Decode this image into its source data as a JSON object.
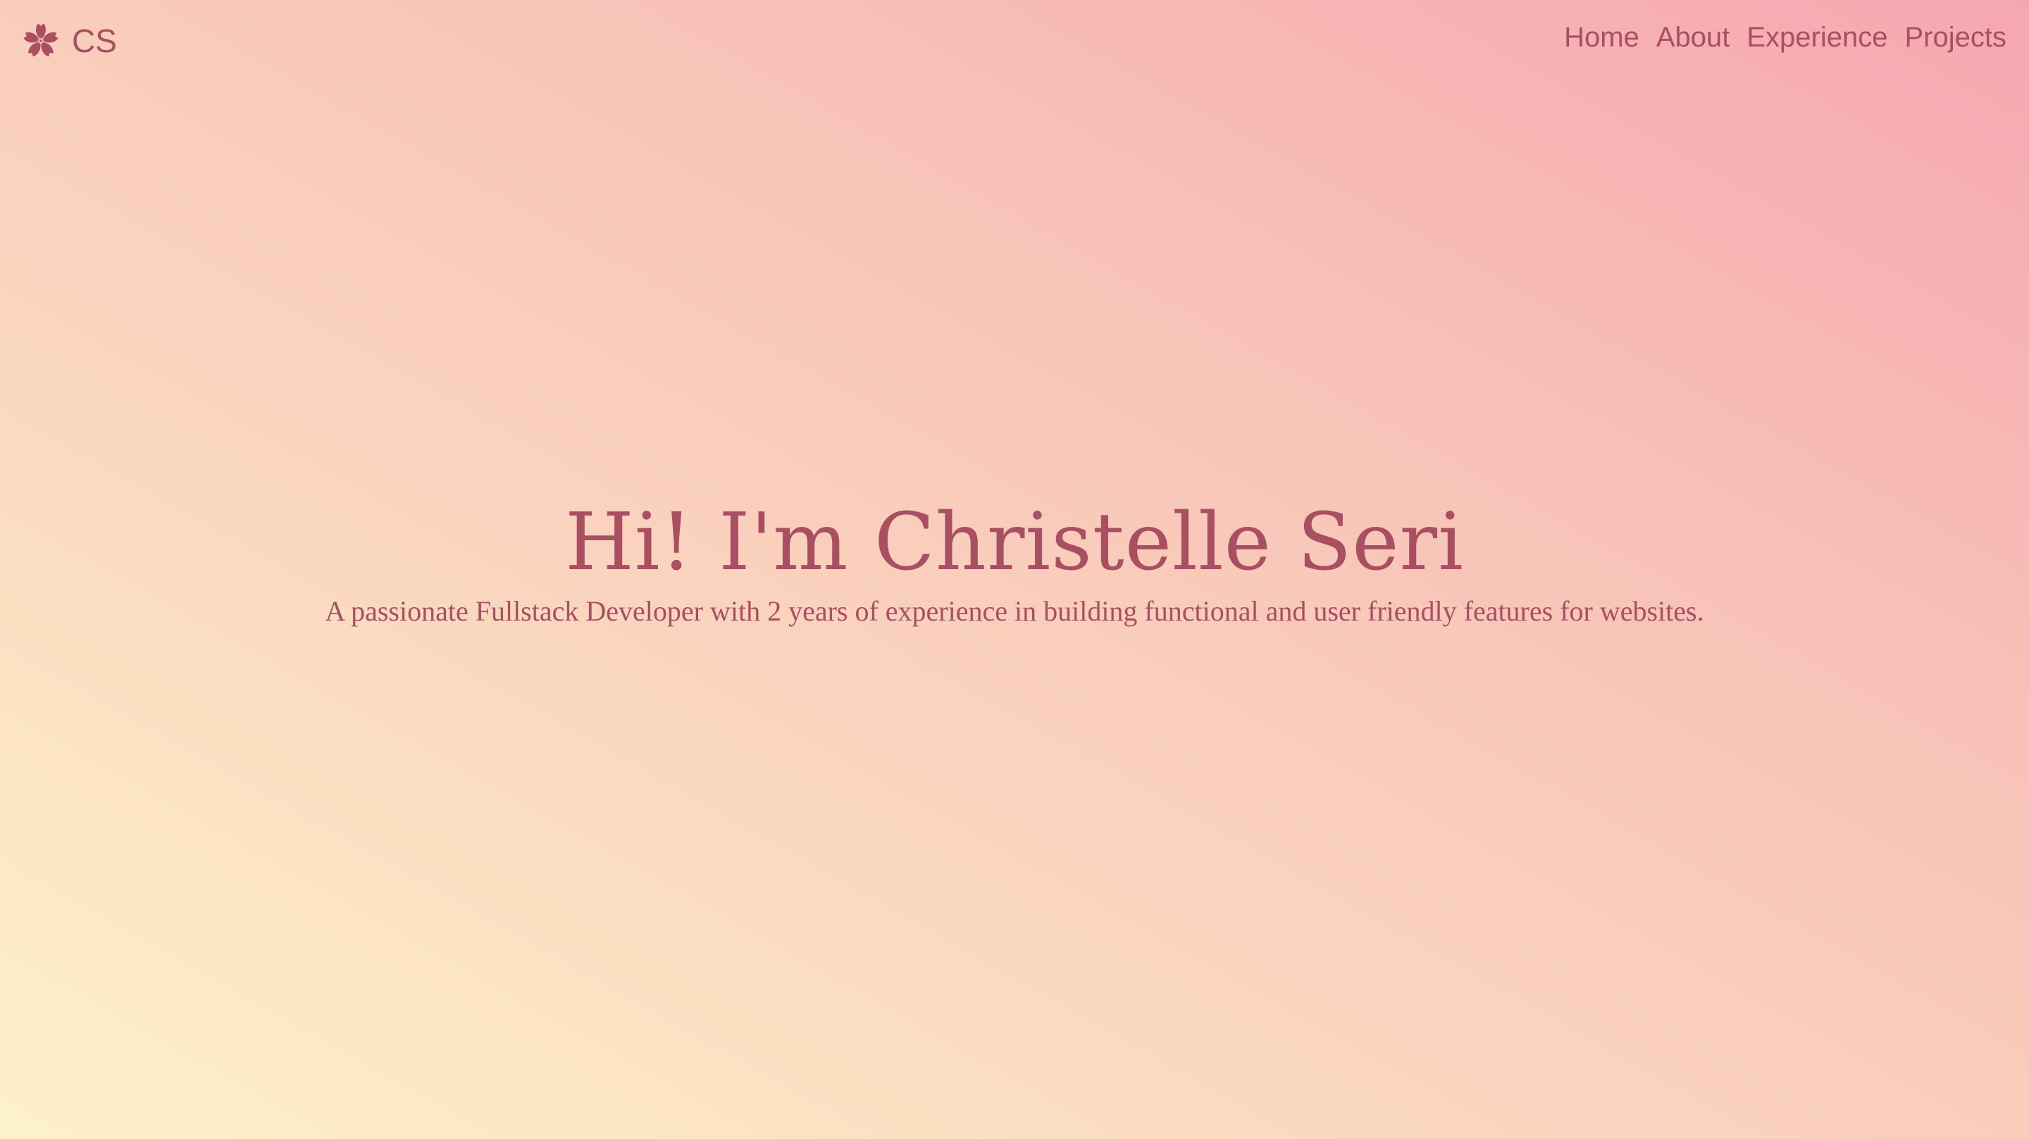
{
  "header": {
    "brand": {
      "icon": "flower-icon",
      "text": "CS"
    },
    "nav": [
      {
        "label": "Home"
      },
      {
        "label": "About"
      },
      {
        "label": "Experience"
      },
      {
        "label": "Projects"
      }
    ]
  },
  "hero": {
    "title": "Hi! I'm Christelle Seri",
    "subtitle": "A passionate Fullstack Developer with 2 years of experience in building functional and user friendly features for websites."
  },
  "colors": {
    "text": "#a84f62",
    "gradient_start": "#fdf2c9",
    "gradient_mid": "#f8c3b8",
    "gradient_end": "#f5a7b0"
  }
}
